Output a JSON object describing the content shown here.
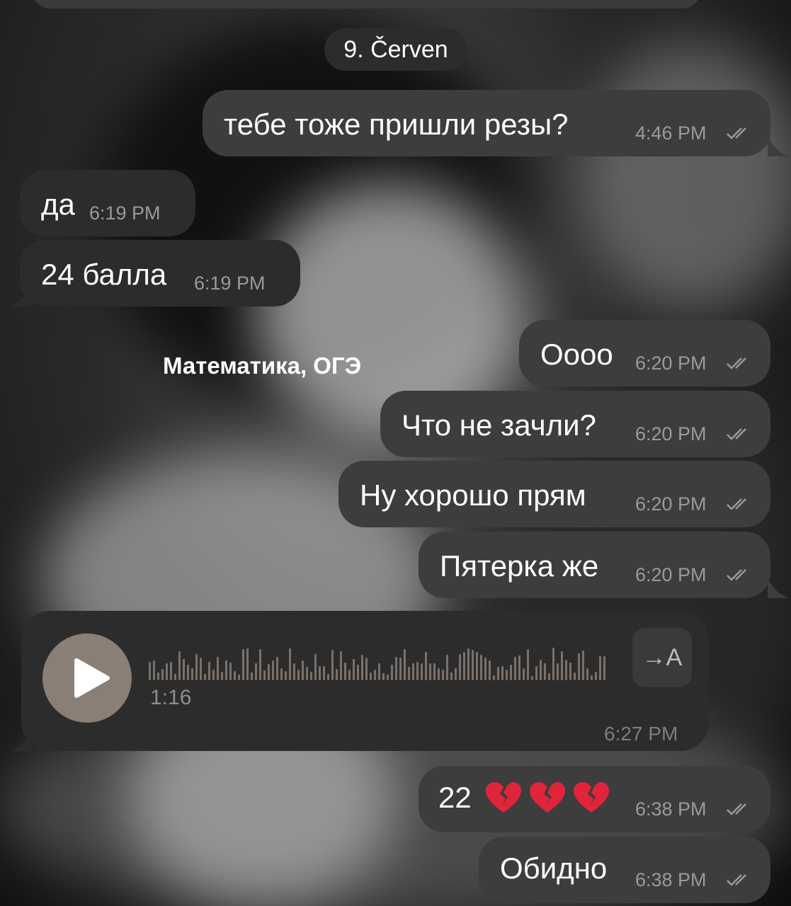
{
  "date_separator": "9. Červen",
  "album_caption": "Математика, ОГЭ",
  "messages": [
    {
      "text": "тебе тоже пришли резы?",
      "time": "4:46 PM"
    },
    {
      "text": "да",
      "time": "6:19 PM"
    },
    {
      "text": "24 балла",
      "time": "6:19 PM"
    },
    {
      "text": "Оооо",
      "time": "6:20 PM"
    },
    {
      "text": "Что не зачли?",
      "time": "6:20 PM"
    },
    {
      "text": "Ну хорошо прям",
      "time": "6:20 PM"
    },
    {
      "text": "Пятерка же",
      "time": "6:20 PM"
    },
    {
      "text": "22",
      "time": "6:38 PM",
      "emoji": [
        "broken-heart",
        "broken-heart",
        "broken-heart"
      ]
    },
    {
      "text": "Обидно",
      "time": "6:38 PM"
    }
  ],
  "voice_message": {
    "duration": "1:16",
    "time": "6:27 PM",
    "transcribe_label": "→A",
    "icons": [
      "play-icon",
      "transcribe-icon"
    ]
  },
  "colors": {
    "outgoing_bubble": "#3d3d3d",
    "incoming_bubble": "#2c2c2c",
    "play_button": "#8a7f76"
  }
}
